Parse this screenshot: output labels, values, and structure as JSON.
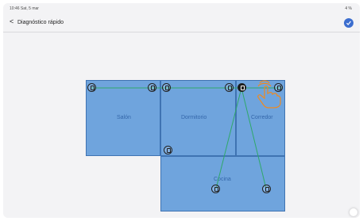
{
  "status_bar": {
    "time": "10:46 Sat, 5 mar",
    "indicators": "4 %"
  },
  "app_bar": {
    "back_label": "<",
    "title": "Diagnóstico rápido"
  },
  "rooms": [
    {
      "name": "Salón"
    },
    {
      "name": "Dormitorio"
    },
    {
      "name": "Corredor"
    },
    {
      "name": "Cocina"
    }
  ],
  "icons": [
    {
      "name": "device-icon-salon-1"
    },
    {
      "name": "device-icon-salon-2"
    },
    {
      "name": "device-icon-dormitorio-1"
    },
    {
      "name": "device-icon-dormitorio-2"
    },
    {
      "name": "router-icon-selected"
    },
    {
      "name": "device-icon-corredor"
    },
    {
      "name": "device-icon-cocina-left"
    },
    {
      "name": "device-icon-cocina-1"
    },
    {
      "name": "device-icon-cocina-2"
    }
  ],
  "colors": {
    "room_fill": "#6fa4dd",
    "room_border": "#3f73b2",
    "link_line": "#2fa86a",
    "accent": "#3c6ecf"
  }
}
